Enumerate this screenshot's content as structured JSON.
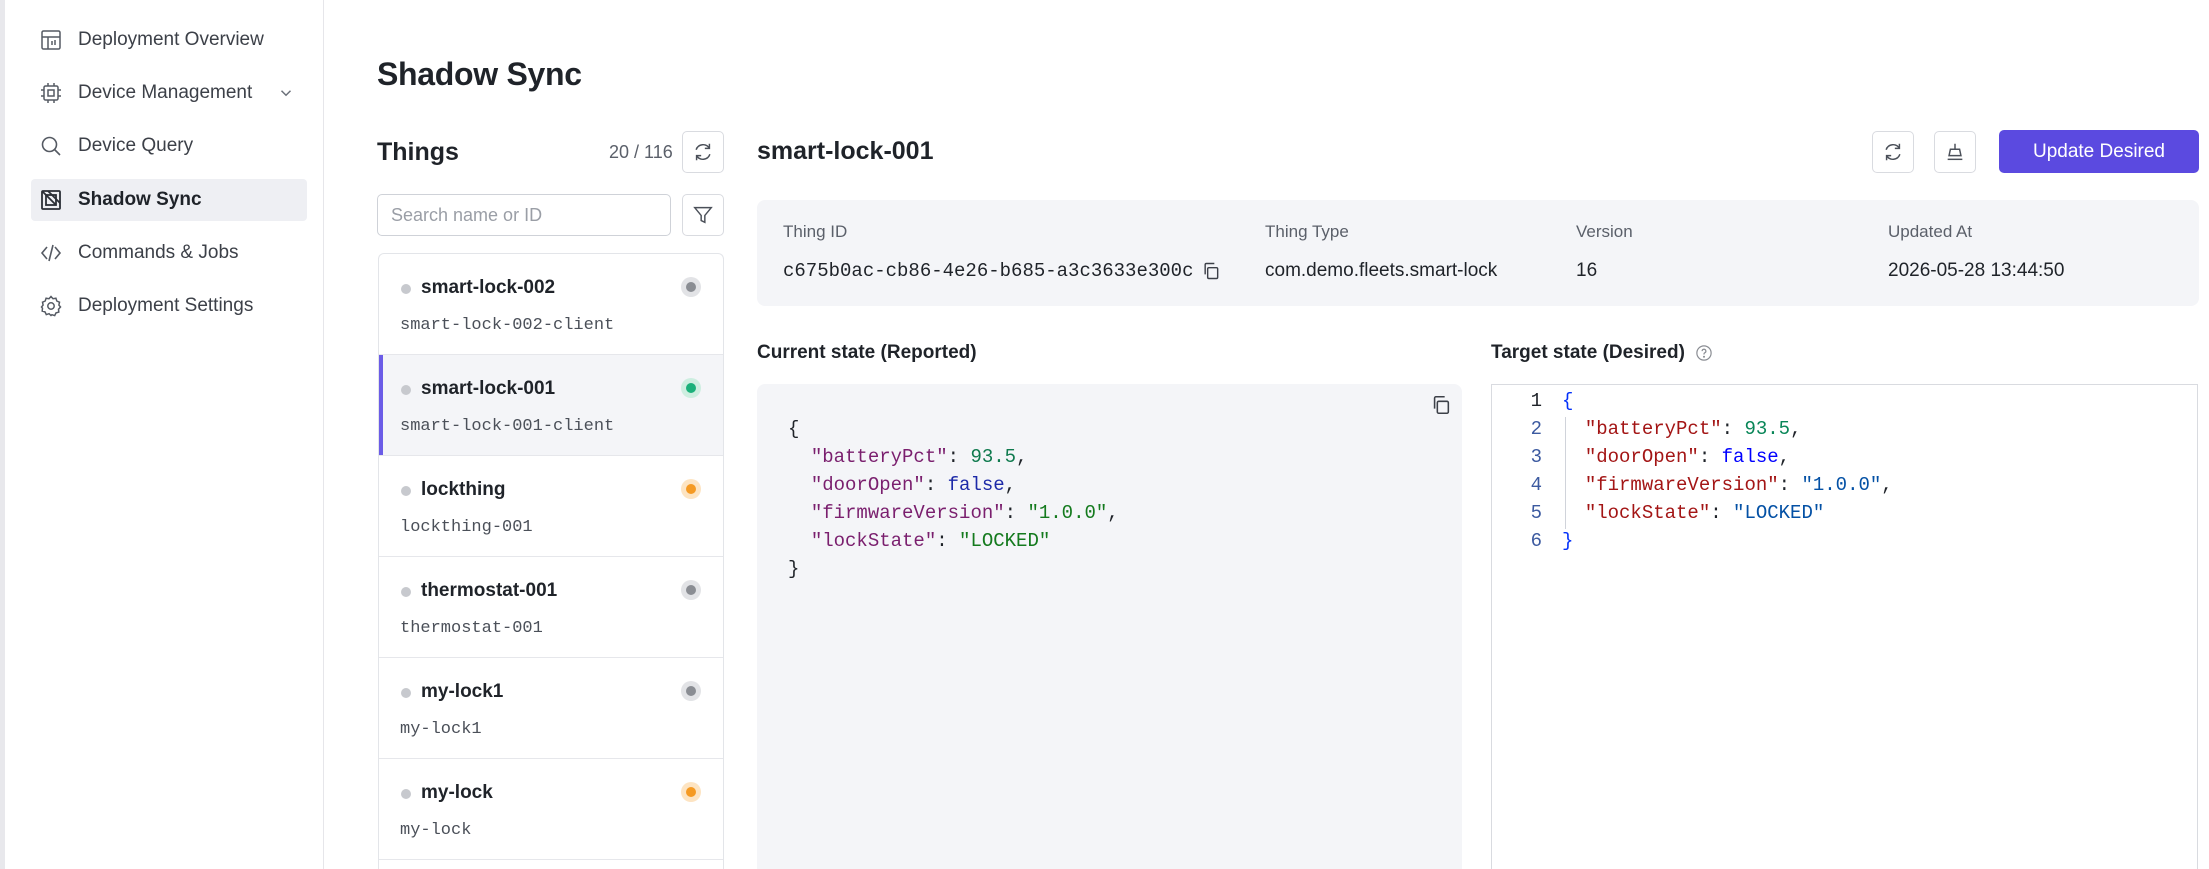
{
  "sidebar": {
    "items": [
      {
        "label": "Deployment Overview",
        "icon": "dashboard-icon"
      },
      {
        "label": "Device Management",
        "icon": "chip-icon"
      },
      {
        "label": "Device Query",
        "icon": "search-icon"
      },
      {
        "label": "Shadow Sync",
        "icon": "shadow-sync-icon"
      },
      {
        "label": "Commands & Jobs",
        "icon": "code-icon"
      },
      {
        "label": "Deployment Settings",
        "icon": "gear-icon"
      }
    ]
  },
  "page": {
    "title": "Shadow Sync"
  },
  "things": {
    "title": "Things",
    "count": "20 / 116",
    "search_placeholder": "Search name or ID",
    "items": [
      {
        "name": "smart-lock-002",
        "client": "smart-lock-002-client",
        "status": "offline",
        "status_color": "#8a8d93"
      },
      {
        "name": "smart-lock-001",
        "client": "smart-lock-001-client",
        "status": "online",
        "status_color": "#1bb07a"
      },
      {
        "name": "lockthing",
        "client": "lockthing-001",
        "status": "warning",
        "status_color": "#f59a23"
      },
      {
        "name": "thermostat-001",
        "client": "thermostat-001",
        "status": "offline",
        "status_color": "#8a8d93"
      },
      {
        "name": "my-lock1",
        "client": "my-lock1",
        "status": "offline",
        "status_color": "#8a8d93"
      },
      {
        "name": "my-lock",
        "client": "my-lock",
        "status": "warning",
        "status_color": "#f59a23"
      }
    ]
  },
  "detail": {
    "title": "smart-lock-001",
    "update_button": "Update Desired",
    "info": {
      "thing_id_label": "Thing ID",
      "thing_id": "c675b0ac-cb86-4e26-b685-a3c3633e300c",
      "thing_type_label": "Thing Type",
      "thing_type": "com.demo.fleets.smart-lock",
      "version_label": "Version",
      "version": "16",
      "updated_label": "Updated At",
      "updated": "2026-05-28 13:44:50"
    },
    "reported_label": "Current state (Reported)",
    "desired_label": "Target state (Desired)",
    "state": {
      "batteryPct": "93.5",
      "doorOpen": "false",
      "firmwareVersion": "\"1.0.0\"",
      "lockState": "\"LOCKED\""
    }
  },
  "colors": {
    "accent": "#5b4ae0",
    "online": "#1bb07a",
    "warning": "#f59a23",
    "offline": "#8a8d93"
  }
}
